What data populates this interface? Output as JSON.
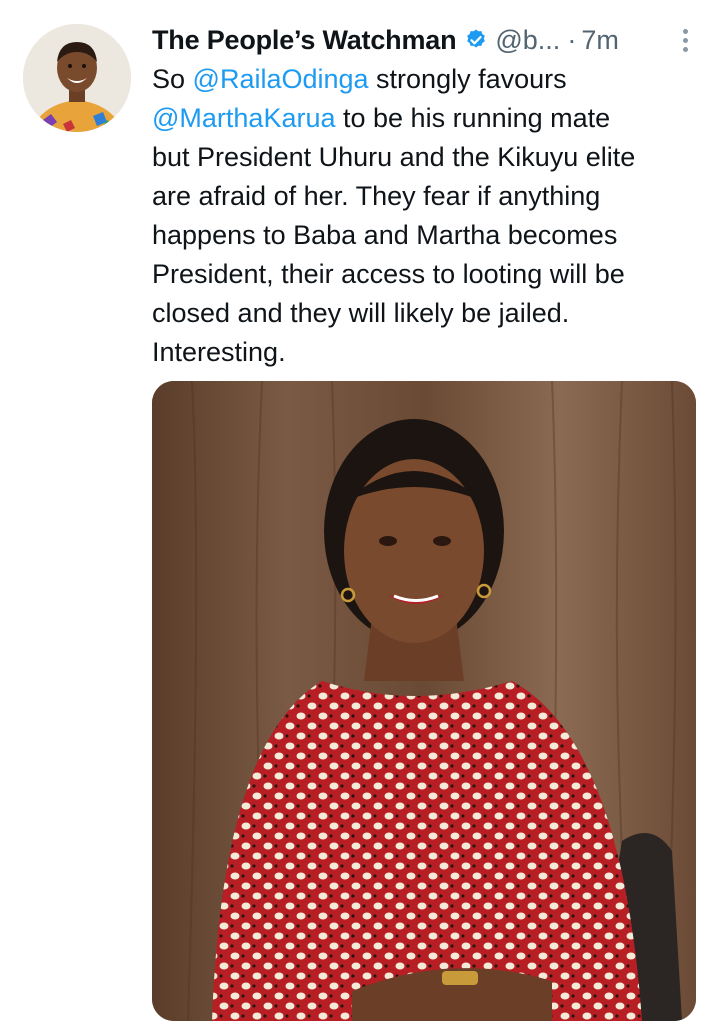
{
  "tweet": {
    "display_name": "The People’s Watchman",
    "handle": "@b...",
    "separator": "·",
    "time": "7m",
    "body": {
      "line1_pre": "So ",
      "line1_mention": "@RailaOdinga",
      "line1_post": " strongly favours",
      "line2_mention": "@MarthaKarua",
      "line2_post": " to be his running mate",
      "line3": "but President Uhuru and the Kikuyu elite",
      "line4": "are afraid of her. They fear if anything",
      "line5": "happens to Baba and Martha becomes",
      "line6": "President, their access to looting will be",
      "line7": "closed and they will likely be jailed.",
      "line8": "Interesting."
    }
  },
  "colors": {
    "link": "#1d9bf0",
    "verified": "#1d9bf0",
    "secondary_text": "#536471",
    "primary_text": "#0f1419"
  },
  "icons": {
    "verified": "verified-badge-icon",
    "more": "more-vertical-icon"
  }
}
